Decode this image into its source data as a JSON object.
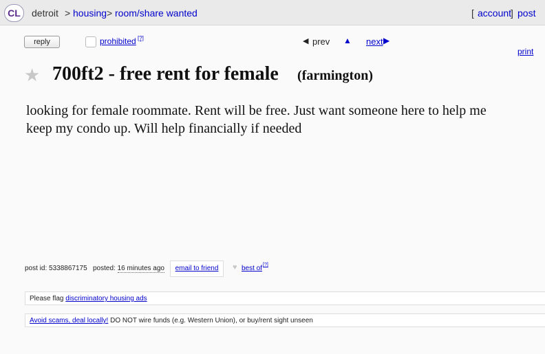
{
  "header": {
    "logo": "CL",
    "city": "detroit",
    "sep1": ">",
    "housing": "housing",
    "sep2": ">",
    "category": "room/share wanted",
    "bracket_left": "[",
    "account": "account",
    "bracket_right": "]",
    "post": "post"
  },
  "actions": {
    "reply": "reply",
    "prohibited": "prohibited",
    "prohibited_help": "[?]",
    "prev_arrow": "◀",
    "prev": "prev",
    "up_arrow": "▲",
    "next": "next",
    "next_arrow": "▶",
    "print": "print"
  },
  "title": {
    "star": "★",
    "main": "700ft2 - free rent for female",
    "location": "(farmington)"
  },
  "body": {
    "text": "looking for female roommate. Rent will be free. Just want someone here to help me keep my condo up. Will help financially if needed"
  },
  "footer": {
    "post_id_label": "post id: 5338867175",
    "posted_label": "posted:",
    "posted_time": "16 minutes ago",
    "email_friend": "email to friend",
    "heart": "♥",
    "best_of": "best of",
    "best_of_help": "[?]"
  },
  "notices": {
    "flag_prefix": "Please flag",
    "flag_link": "discriminatory housing ads",
    "scam_link": "Avoid scams, deal locally!",
    "scam_text": "DO NOT wire funds (e.g. Western Union), or buy/rent sight unseen"
  }
}
